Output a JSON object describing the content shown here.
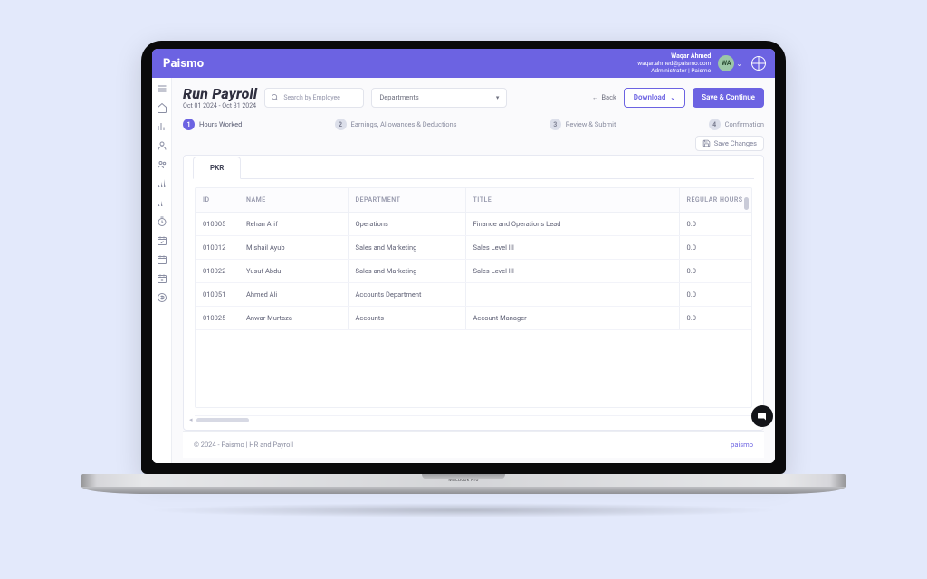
{
  "brand": "Paismo",
  "user": {
    "name": "Waqar Ahmed",
    "email": "waqar.ahmed@paismo.com",
    "role": "Administrator | Paismo",
    "initials": "WA"
  },
  "page": {
    "title": "Run Payroll",
    "range": "Oct 01 2024 - Oct 31 2024"
  },
  "search": {
    "placeholder": "Search by Employee"
  },
  "departments": {
    "label": "Departments"
  },
  "actions": {
    "back": "Back",
    "download": "Download",
    "save_continue": "Save & Continue",
    "save_changes": "Save Changes"
  },
  "steps": {
    "s1": {
      "num": "1",
      "label": "Hours Worked"
    },
    "s2": {
      "num": "2",
      "label": "Earnings, Allowances & Deductions"
    },
    "s3": {
      "num": "3",
      "label": "Review & Submit"
    },
    "s4": {
      "num": "4",
      "label": "Confirmation"
    }
  },
  "tab": {
    "currency": "PKR"
  },
  "columns": {
    "id": "ID",
    "name": "NAME",
    "department": "DEPARTMENT",
    "title": "TITLE",
    "hours": "REGULAR HOURS"
  },
  "rows": [
    {
      "id": "010005",
      "name": "Rehan Arif",
      "department": "Operations",
      "title": "Finance and Operations Lead",
      "hours": "0.0"
    },
    {
      "id": "010012",
      "name": "Mishail Ayub",
      "department": "Sales and Marketing",
      "title": "Sales Level III",
      "hours": "0.0"
    },
    {
      "id": "010022",
      "name": "Yusuf Abdul",
      "department": "Sales and Marketing",
      "title": "Sales Level III",
      "hours": "0.0"
    },
    {
      "id": "010051",
      "name": "Ahmed Ali",
      "department": "Accounts Department",
      "title": "",
      "hours": "0.0"
    },
    {
      "id": "010025",
      "name": "Anwar Murtaza",
      "department": "Accounts",
      "title": "Account Manager",
      "hours": "0.0"
    }
  ],
  "footer": {
    "left": "© 2024 - Paismo | HR and Payroll",
    "right": "paismo"
  },
  "laptop": {
    "label": "MacBook Pro"
  }
}
